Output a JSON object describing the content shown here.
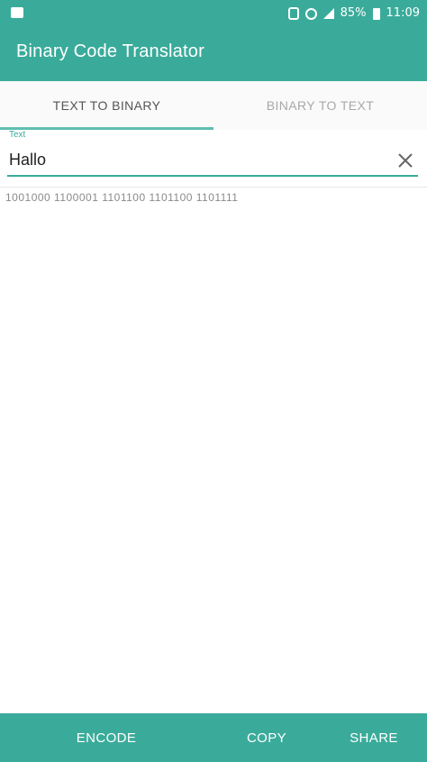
{
  "status_bar": {
    "battery": "85%",
    "time": "11:09",
    "icons": [
      "notification-icon",
      "vibrate-icon",
      "alarm-icon",
      "signal-icon",
      "battery-icon"
    ]
  },
  "app_bar": {
    "title": "Binary Code Translator"
  },
  "tabs": [
    {
      "label": "TEXT TO BINARY",
      "active": true
    },
    {
      "label": "BINARY TO TEXT",
      "active": false
    }
  ],
  "input": {
    "label": "Text",
    "value": "Hallo"
  },
  "output": {
    "binary": "1001000 1100001 1101100 1101100 1101111"
  },
  "bottom_bar": {
    "encode_label": "ENCODE",
    "copy_label": "COPY",
    "share_label": "SHARE"
  },
  "colors": {
    "primary": "#3aab9a",
    "tab_indicator": "#5fbfb1",
    "background": "#ffffff"
  }
}
